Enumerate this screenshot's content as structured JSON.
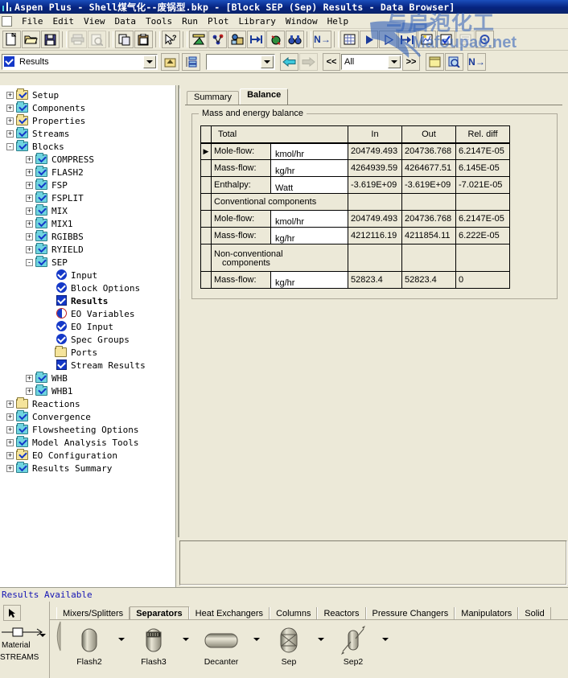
{
  "window": {
    "title": "Aspen Plus - Shell煤气化--废锅型.bkp - [Block SEP (Sep) Results - Data Browser]",
    "logo_icon": "aspen-logo-icon"
  },
  "watermark": {
    "text_top": "与启泡化工",
    "text_bottom": "Mafoupao.net"
  },
  "menu": {
    "items": [
      {
        "label": "File"
      },
      {
        "label": "Edit"
      },
      {
        "label": "View"
      },
      {
        "label": "Data"
      },
      {
        "label": "Tools"
      },
      {
        "label": "Run"
      },
      {
        "label": "Plot"
      },
      {
        "label": "Library"
      },
      {
        "label": "Window"
      },
      {
        "label": "Help"
      }
    ]
  },
  "toolbar": {
    "buttons": [
      {
        "name": "new-icon",
        "tip": "New"
      },
      {
        "name": "open-icon",
        "tip": "Open"
      },
      {
        "name": "save-icon",
        "tip": "Save"
      },
      {
        "name": "print-icon",
        "tip": "Print"
      },
      {
        "name": "print-preview-icon",
        "tip": "Print Preview"
      },
      {
        "name": "copy-icon",
        "tip": "Copy"
      },
      {
        "name": "paste-icon",
        "tip": "Paste"
      },
      {
        "name": "help-pointer-icon",
        "tip": "Help"
      },
      {
        "name": "properties-chart-icon",
        "tip": "Properties"
      },
      {
        "name": "components-icon",
        "tip": "Components"
      },
      {
        "name": "flowsheet-icon",
        "tip": "Flowsheet"
      },
      {
        "name": "streams-icon",
        "tip": "Stream Summary"
      },
      {
        "name": "convergence-icon",
        "tip": "Convergence"
      },
      {
        "name": "binoculars-icon",
        "tip": "Find"
      },
      {
        "name": "next-input-icon",
        "tip": "Next"
      },
      {
        "name": "table-icon",
        "tip": "Results Table"
      },
      {
        "name": "run-icon",
        "tip": "Run"
      },
      {
        "name": "step-icon",
        "tip": "Step"
      },
      {
        "name": "reinitialize-icon",
        "tip": "Reinitialize"
      },
      {
        "name": "control-panel-icon",
        "tip": "Control Panel"
      },
      {
        "name": "check-results-icon",
        "tip": "Check Results"
      },
      {
        "name": "report-icon",
        "tip": "Report"
      },
      {
        "name": "settings-icon",
        "tip": "Settings"
      }
    ]
  },
  "navbar": {
    "object_combo_value": "Results",
    "object_combo_checked": true,
    "up_folder_icon": "up-folder-icon",
    "tree_view_icon": "tree-view-icon",
    "secondary_combo_value": "",
    "back_icon": "back-arrow-icon",
    "forward_icon": "forward-arrow-icon",
    "prev_label": "<<",
    "scope_combo_value": "All",
    "next_label": ">>",
    "notes_icon": "notes-icon",
    "zoom-find_icon": "find-zoom-icon",
    "next_input_label": "N→"
  },
  "tree": {
    "items": [
      {
        "label": "Setup",
        "level": 0,
        "expander": "+",
        "icon": "folder-yellow-check"
      },
      {
        "label": "Components",
        "level": 0,
        "expander": "+",
        "icon": "folder-cyan-check"
      },
      {
        "label": "Properties",
        "level": 0,
        "expander": "+",
        "icon": "folder-yellow-check"
      },
      {
        "label": "Streams",
        "level": 0,
        "expander": "+",
        "icon": "folder-cyan-check"
      },
      {
        "label": "Blocks",
        "level": 0,
        "expander": "-",
        "icon": "folder-cyan-check"
      },
      {
        "label": "COMPRESS",
        "level": 1,
        "expander": "+",
        "icon": "folder-cyan-check"
      },
      {
        "label": "FLASH2",
        "level": 1,
        "expander": "+",
        "icon": "folder-cyan-check"
      },
      {
        "label": "FSP",
        "level": 1,
        "expander": "+",
        "icon": "folder-cyan-check"
      },
      {
        "label": "FSPLIT",
        "level": 1,
        "expander": "+",
        "icon": "folder-cyan-check"
      },
      {
        "label": "MIX",
        "level": 1,
        "expander": "+",
        "icon": "folder-cyan-check"
      },
      {
        "label": "MIX1",
        "level": 1,
        "expander": "+",
        "icon": "folder-cyan-check"
      },
      {
        "label": "RGIBBS",
        "level": 1,
        "expander": "+",
        "icon": "folder-cyan-check"
      },
      {
        "label": "RYIELD",
        "level": 1,
        "expander": "+",
        "icon": "folder-cyan-check"
      },
      {
        "label": "SEP",
        "level": 1,
        "expander": "-",
        "icon": "folder-cyan-check"
      },
      {
        "label": "Input",
        "level": 2,
        "expander": "",
        "icon": "circle-check"
      },
      {
        "label": "Block Options",
        "level": 2,
        "expander": "",
        "icon": "circle-check"
      },
      {
        "label": "Results",
        "level": 2,
        "expander": "",
        "icon": "square-check",
        "bold": true
      },
      {
        "label": "EO Variables",
        "level": 2,
        "expander": "",
        "icon": "half-circle"
      },
      {
        "label": "EO Input",
        "level": 2,
        "expander": "",
        "icon": "circle-check"
      },
      {
        "label": "Spec Groups",
        "level": 2,
        "expander": "",
        "icon": "circle-check"
      },
      {
        "label": "Ports",
        "level": 2,
        "expander": "",
        "icon": "folder-plain"
      },
      {
        "label": "Stream Results",
        "level": 2,
        "expander": "",
        "icon": "square-check"
      },
      {
        "label": "WHB",
        "level": 1,
        "expander": "+",
        "icon": "folder-cyan-check"
      },
      {
        "label": "WHB1",
        "level": 1,
        "expander": "+",
        "icon": "folder-cyan-check"
      },
      {
        "label": "Reactions",
        "level": 0,
        "expander": "+",
        "icon": "folder-plain"
      },
      {
        "label": "Convergence",
        "level": 0,
        "expander": "+",
        "icon": "folder-cyan-check"
      },
      {
        "label": "Flowsheeting Options",
        "level": 0,
        "expander": "+",
        "icon": "folder-cyan-check"
      },
      {
        "label": "Model Analysis Tools",
        "level": 0,
        "expander": "+",
        "icon": "folder-cyan-check"
      },
      {
        "label": "EO Configuration",
        "level": 0,
        "expander": "+",
        "icon": "folder-yellow-check"
      },
      {
        "label": "Results Summary",
        "level": 0,
        "expander": "+",
        "icon": "folder-cyan-check"
      }
    ]
  },
  "form": {
    "tabs": [
      {
        "label": "Summary",
        "active": false
      },
      {
        "label": "Balance",
        "active": true
      }
    ],
    "group_legend": "Mass and energy balance",
    "table": {
      "columns": [
        "Total",
        "In",
        "Out",
        "Rel. diff"
      ],
      "rows": [
        {
          "type": "data",
          "selected": true,
          "label": "Mole-flow:",
          "unit": "kmol/hr",
          "in": "204749.493",
          "out": "204736.768",
          "rel": "6.2147E-05"
        },
        {
          "type": "data",
          "selected": false,
          "label": "Mass-flow:",
          "unit": "kg/hr",
          "in": "4264939.59",
          "out": "4264677.51",
          "rel": "6.145E-05"
        },
        {
          "type": "data",
          "selected": false,
          "label": "Enthalpy:",
          "unit": "Watt",
          "in": "-3.619E+09",
          "out": "-3.619E+09",
          "rel": "-7.021E-05"
        },
        {
          "type": "section",
          "label": "Conventional components"
        },
        {
          "type": "data",
          "selected": false,
          "label": "Mole-flow:",
          "unit": "kmol/hr",
          "in": "204749.493",
          "out": "204736.768",
          "rel": "6.2147E-05"
        },
        {
          "type": "data",
          "selected": false,
          "label": "Mass-flow:",
          "unit": "kg/hr",
          "in": "4212116.19",
          "out": "4211854.11",
          "rel": "6.222E-05"
        },
        {
          "type": "section2",
          "label_line1": "Non-conventional",
          "label_line2": "components"
        },
        {
          "type": "data",
          "selected": false,
          "label": "Mass-flow:",
          "unit": "kg/hr",
          "in": "52823.4",
          "out": "52823.4",
          "rel": "0"
        }
      ]
    }
  },
  "status": {
    "text": "Results Available"
  },
  "palette": {
    "cursor_icon": "arrow-cursor-icon",
    "stream_label": "Material",
    "stream_group_label": "STREAMS",
    "stream_icon": "material-stream-icon",
    "tabs": [
      {
        "label": "Mixers/Splitters",
        "active": false
      },
      {
        "label": "Separators",
        "active": true
      },
      {
        "label": "Heat Exchangers",
        "active": false
      },
      {
        "label": "Columns",
        "active": false
      },
      {
        "label": "Reactors",
        "active": false
      },
      {
        "label": "Pressure Changers",
        "active": false
      },
      {
        "label": "Manipulators",
        "active": false
      },
      {
        "label": "Solid",
        "active": false
      }
    ],
    "items": [
      {
        "label": "Flash2",
        "icon": "flash2-vessel-icon"
      },
      {
        "label": "Flash3",
        "icon": "flash3-vessel-icon"
      },
      {
        "label": "Decanter",
        "icon": "decanter-vessel-icon"
      },
      {
        "label": "Sep",
        "icon": "sep-vessel-icon"
      },
      {
        "label": "Sep2",
        "icon": "sep2-vessel-icon"
      }
    ]
  },
  "colors": {
    "titlebar": "#0a246a",
    "face": "#ece9d8",
    "status_text": "#1414b4",
    "accent_check": "#1438c8"
  }
}
